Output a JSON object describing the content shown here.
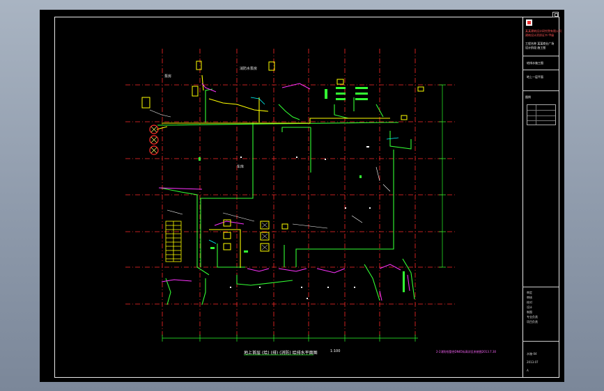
{
  "drawing": {
    "caption_title": "地上首层 (给) (排) (消防) 给排水平面图",
    "caption_scale": "1:100",
    "bottom_note": "2-2消防栓管径DN65标高详见系统图2013.7.30"
  },
  "room_labels": [
    "泵房",
    "消防水泵房",
    "车库"
  ],
  "title_block": {
    "company_lines": [
      "某某建筑设计研究院有限公司",
      "建筑设计资质证书 甲级",
      "工程名称 某某商业广场",
      "设计阶段 施工图"
    ],
    "project": "给排水施工图",
    "sheet_name": "地上一层平面",
    "legend_label": "图例",
    "sign_rows": [
      "审定",
      "审核",
      "校对",
      "设计",
      "制图",
      "专业负责",
      "项目负责"
    ],
    "drawing_no": "水施-04",
    "date": "2013.07",
    "version": "A"
  },
  "colors": {
    "grid": "#ff2a2a",
    "pipe_green": "#33ff33",
    "pipe_yellow": "#ffff00",
    "pipe_magenta": "#ff33ff",
    "pipe_cyan": "#00ffff",
    "pipe_white": "#ffffff"
  }
}
